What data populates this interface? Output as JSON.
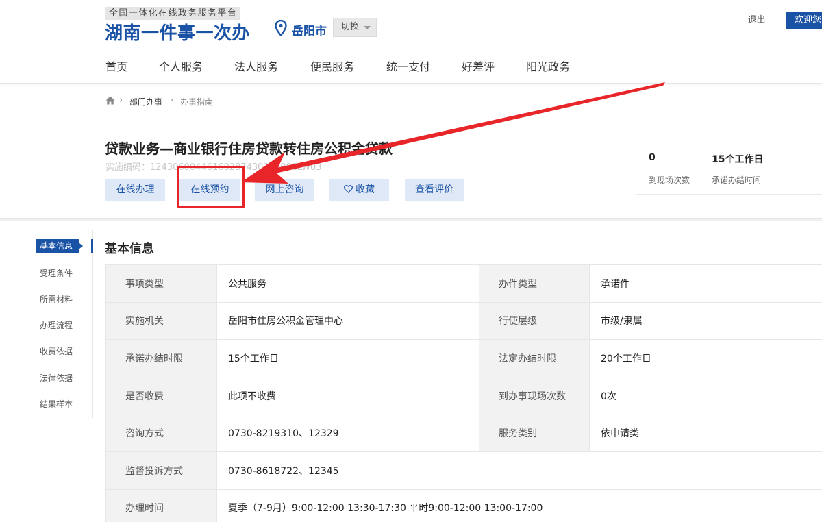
{
  "header": {
    "platform_label": "全国一体化在线政务服务平台",
    "site_title": "湖南一件事一次办",
    "city": "岳阳市",
    "switch_label": "切换",
    "logout_label": "退出",
    "welcome_label": "欢迎您"
  },
  "nav": {
    "items": [
      "首页",
      "个人服务",
      "法人服务",
      "便民服务",
      "统一支付",
      "好差评",
      "阳光政务"
    ]
  },
  "breadcrumb": {
    "items": [
      "部门办事",
      "办事指南"
    ]
  },
  "item": {
    "title": "贷款业务—商业银行住房贷款转住房公积金贷款",
    "code": "实施编码：12430600446160287430230000LW03",
    "actions": [
      "在线办理",
      "在线预约",
      "网上咨询",
      "收藏",
      "查看评价"
    ]
  },
  "stats": [
    {
      "value": "0",
      "label": "到现场次数"
    },
    {
      "value": "15个工作日",
      "label": "承诺办结时间"
    }
  ],
  "side_nav": {
    "items": [
      "基本信息",
      "受理条件",
      "所需材料",
      "办理流程",
      "收费依据",
      "法律依据",
      "结果样本"
    ]
  },
  "basic_info": {
    "title": "基本信息",
    "rows": [
      [
        "事项类型",
        "公共服务",
        "办件类型",
        "承诺件"
      ],
      [
        "实施机关",
        "岳阳市住房公积金管理中心",
        "行使层级",
        "市级/隶属"
      ],
      [
        "承诺办结时限",
        "15个工作日",
        "法定办结时限",
        "20个工作日"
      ],
      [
        "是否收费",
        "此项不收费",
        "到办事现场次数",
        "0次"
      ],
      [
        "咨询方式",
        "0730-8219310、12329",
        "服务类别",
        "依申请类"
      ],
      [
        "监督投诉方式",
        "0730-8618722、12345"
      ],
      [
        "办理时间",
        "夏季（7-9月）9:00-12:00 13:30-17:30 平时9:00-12:00 13:00-17:00"
      ]
    ]
  },
  "annotation": {
    "color": "#e8262a",
    "target": "在线预约"
  }
}
